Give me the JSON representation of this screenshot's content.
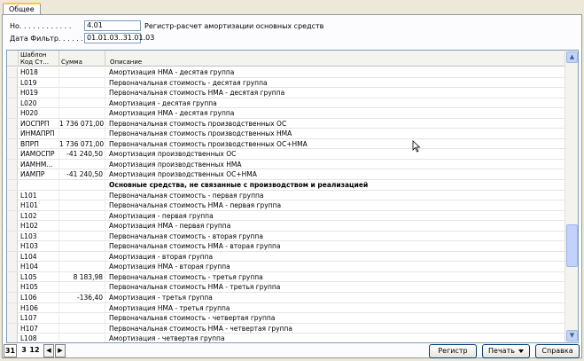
{
  "tab": {
    "label": "Общее"
  },
  "fields": {
    "number_label": "Но. . . . . . . . . . . .",
    "number_value": "4.01",
    "number_desc": "Регистр-расчет амортизации основных средств",
    "date_filter_label": "Дата Фильтр. . . . . .",
    "date_filter_value": "01.01.03..31.01.03"
  },
  "grid": {
    "header": {
      "col_code_line1": "Шаблон",
      "col_code_line2": "Код Ст...",
      "col_sum": "Сумма",
      "col_desc": "Описание"
    },
    "rows": [
      {
        "code": "H018",
        "sum": "",
        "desc": "Амортизация НМА - десятая группа"
      },
      {
        "code": "L019",
        "sum": "",
        "desc": "Первоначальная стоимость - десятая группа"
      },
      {
        "code": "H019",
        "sum": "",
        "desc": "Первоначальная стоимость НМА - десятая группа"
      },
      {
        "code": "L020",
        "sum": "",
        "desc": "Амортизация - десятая группа"
      },
      {
        "code": "H020",
        "sum": "",
        "desc": "Амортизация НМА - десятая группа"
      },
      {
        "code": "ИОСПРП",
        "sum": "1 736 071,00",
        "desc": "Первоначальная стоимость производственных ОС"
      },
      {
        "code": "ИНМАПРП",
        "sum": "",
        "desc": "Первоначальная стоимость производственных НМА"
      },
      {
        "code": "ВПРП",
        "sum": "1 736 071,00",
        "desc": "Первоначальная стоимость производственных ОС+НМА"
      },
      {
        "code": "ИАМОСПР",
        "sum": "-41 240,50",
        "desc": "Амортизация производственных ОС"
      },
      {
        "code": "ИАМНМ...",
        "sum": "",
        "desc": "Амортизация производственных НМА"
      },
      {
        "code": "ИАМПР",
        "sum": "-41 240,50",
        "desc": "Амортизация производственных ОС+НМА"
      },
      {
        "code": "",
        "sum": "",
        "desc": "Основные средства, не связанные с производством и реализацией",
        "group": true
      },
      {
        "code": "L101",
        "sum": "",
        "desc": "Первоначальная стоимость - первая группа"
      },
      {
        "code": "H101",
        "sum": "",
        "desc": "Первоначальная стоимость НМА - первая группа"
      },
      {
        "code": "L102",
        "sum": "",
        "desc": "Амортизация - первая группа"
      },
      {
        "code": "H102",
        "sum": "",
        "desc": "Амортизация НМА - первая группа"
      },
      {
        "code": "L103",
        "sum": "",
        "desc": "Первоначальная стоимость - вторая группа"
      },
      {
        "code": "H103",
        "sum": "",
        "desc": "Первоначальная стоимость НМА - вторая группа"
      },
      {
        "code": "L104",
        "sum": "",
        "desc": "Амортизация - вторая группа"
      },
      {
        "code": "H104",
        "sum": "",
        "desc": "Амортизация НМА - вторая группа"
      },
      {
        "code": "L105",
        "sum": "8 183,98",
        "desc": "Первоначальная стоимость - третья группа"
      },
      {
        "code": "H105",
        "sum": "",
        "desc": "Первоначальная стоимость НМА - третья группа"
      },
      {
        "code": "L106",
        "sum": "-136,40",
        "desc": "Амортизация - третья группа"
      },
      {
        "code": "H106",
        "sum": "",
        "desc": "Амортизация НМА - третья группа"
      },
      {
        "code": "L107",
        "sum": "",
        "desc": "Первоначальная стоимость - четвертая группа"
      },
      {
        "code": "H107",
        "sum": "",
        "desc": "Первоначальная стоимость НМА - четвертая группа"
      },
      {
        "code": "L108",
        "sum": "",
        "desc": "Амортизация - четвертая группа"
      },
      {
        "code": "H108",
        "sum": "",
        "desc": "Амортизация НМА - четвертая группа",
        "current": true
      }
    ]
  },
  "bottom": {
    "page_current": "31",
    "page_a": "3",
    "page_b": "12",
    "register_button": "Регистр",
    "print_button": "Печать",
    "help_button": "Справка"
  }
}
